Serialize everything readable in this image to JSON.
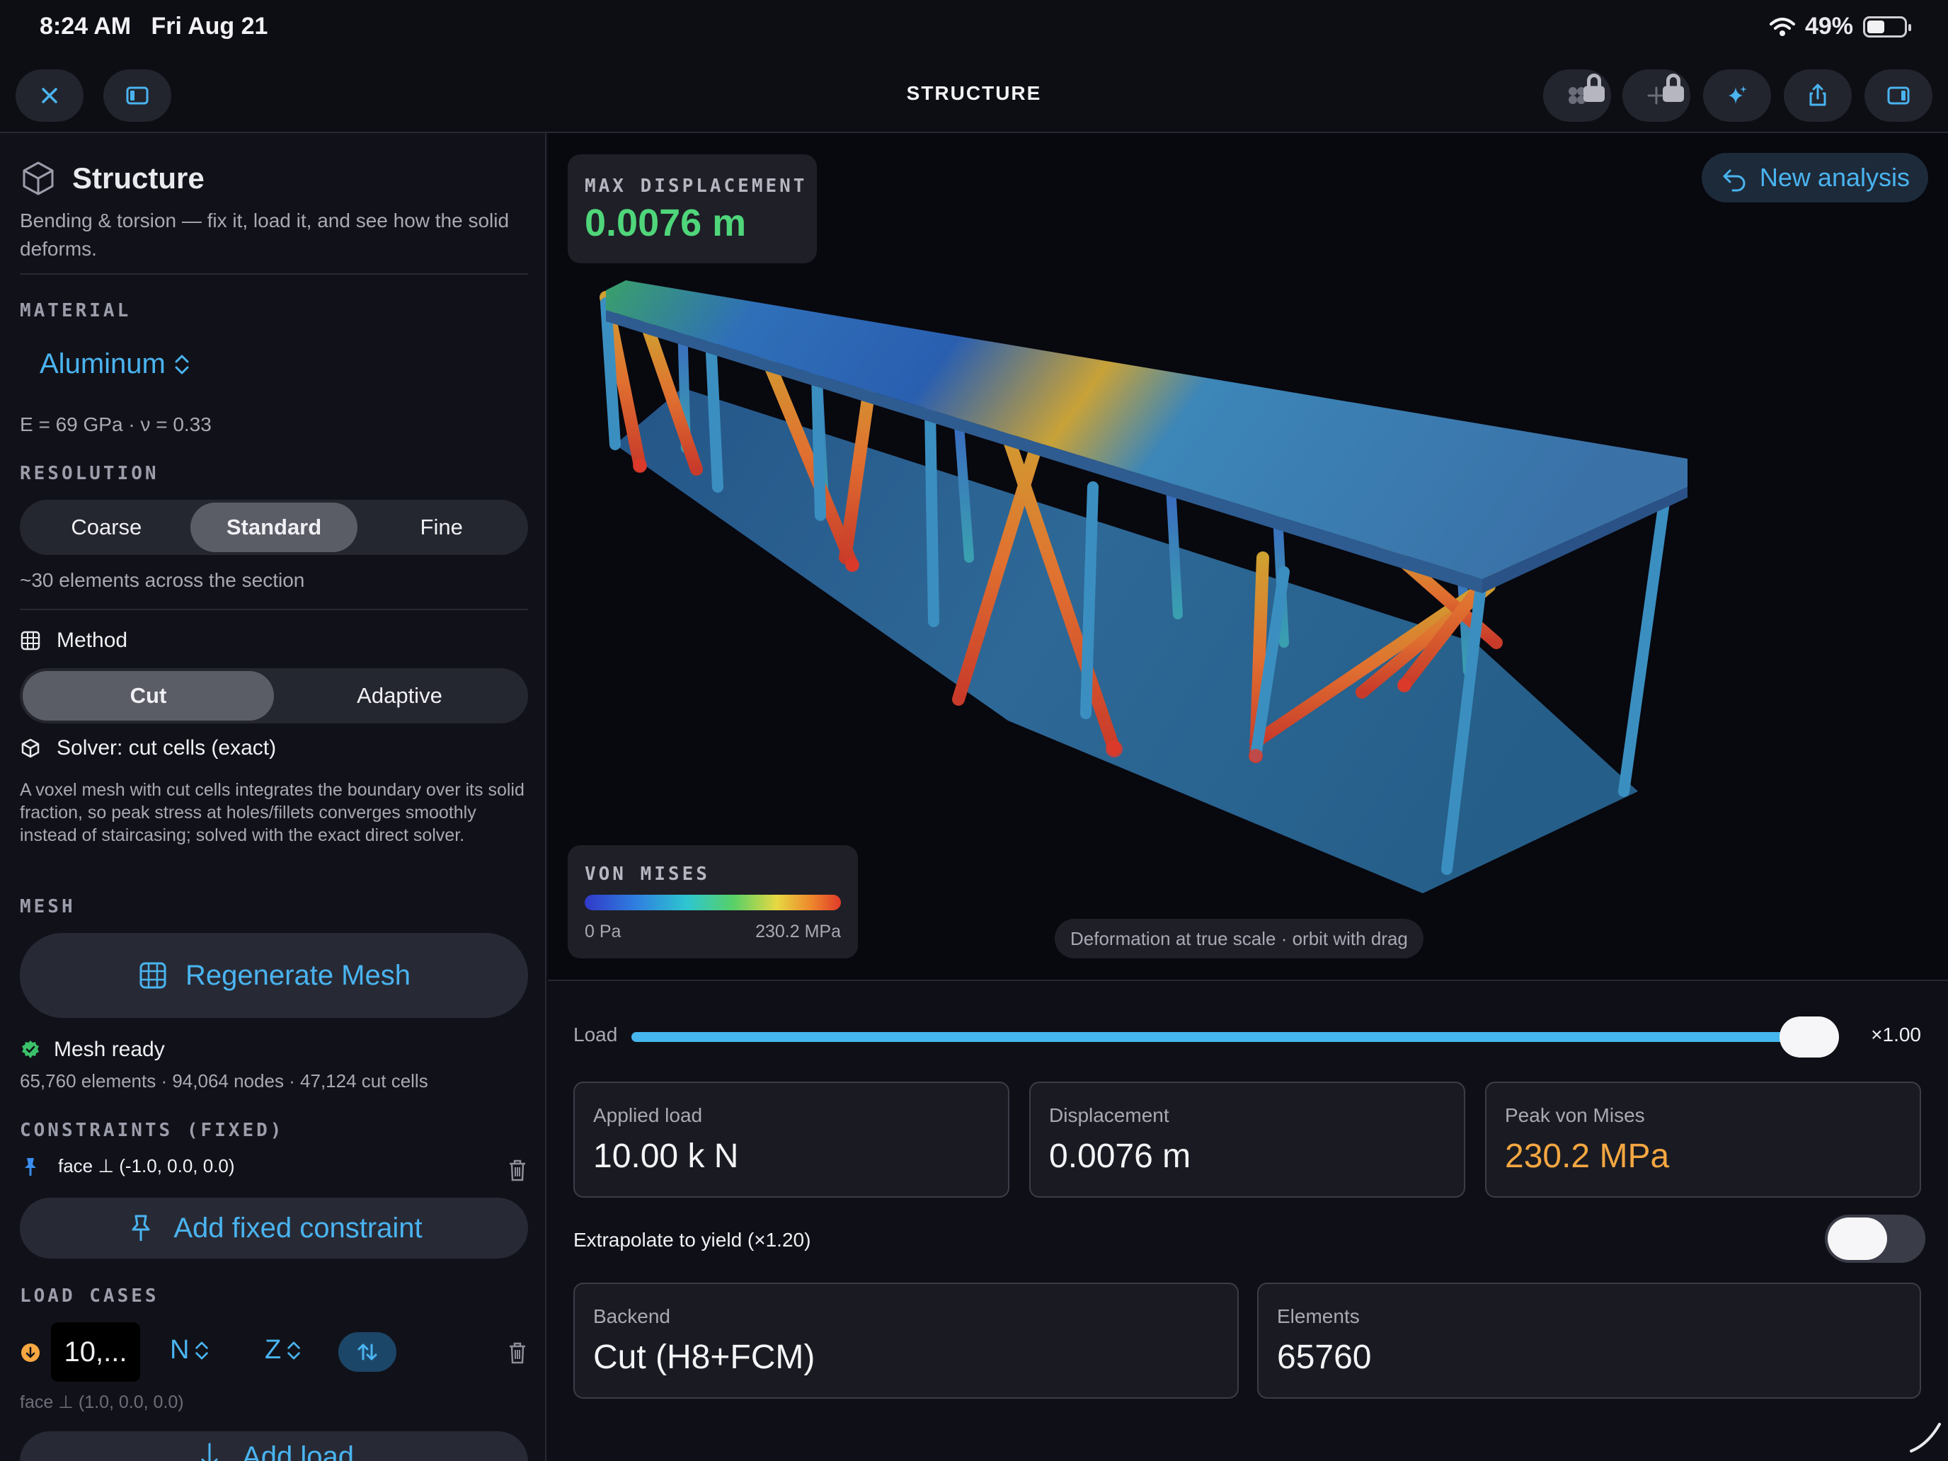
{
  "status": {
    "time": "8:24 AM",
    "date": "Fri Aug 21",
    "battery": "49%"
  },
  "toolbar": {
    "title": "STRUCTURE"
  },
  "sidebar": {
    "title": "Structure",
    "subtitle": "Bending & torsion — fix it, load it, and see how the solid deforms.",
    "material_label": "MATERIAL",
    "material_value": "Aluminum",
    "material_props": "E = 69 GPa · ν = 0.33",
    "resolution_label": "RESOLUTION",
    "resolution_options": [
      "Coarse",
      "Standard",
      "Fine"
    ],
    "resolution_selected": "Standard",
    "resolution_hint": "~30 elements across the section",
    "method_label": "Method",
    "method_options": [
      "Cut",
      "Adaptive"
    ],
    "method_selected": "Cut",
    "solver_label": "Solver: cut cells (exact)",
    "solver_desc": "A voxel mesh with cut cells integrates the boundary over its solid fraction, so peak stress at holes/fillets converges smoothly instead of staircasing; solved with the exact direct solver.",
    "mesh_label": "MESH",
    "regen_label": "Regenerate Mesh",
    "mesh_status": "Mesh ready",
    "mesh_stats": "65,760 elements · 94,064 nodes · 47,124 cut cells",
    "constraints_label": "CONSTRAINTS (FIXED)",
    "constraint_item": "face ⊥ (-1.0, 0.0, 0.0)",
    "add_constraint_label": "Add fixed constraint",
    "loadcases_label": "LOAD CASES",
    "load_value": "10,...",
    "load_unit": "N",
    "load_axis": "Z",
    "load_face": "face ⊥ (1.0, 0.0, 0.0)",
    "add_load_label": "Add load"
  },
  "viewport": {
    "maxdisp_label": "MAX DISPLACEMENT",
    "maxdisp_value": "0.0076 m",
    "new_analysis_label": "New analysis",
    "legend_title": "VON MISES",
    "legend_min": "0 Pa",
    "legend_max": "230.2 MPa",
    "hint": "Deformation at true scale · orbit with drag"
  },
  "panel": {
    "load_label": "Load",
    "load_multiplier": "×1.00",
    "load_fraction": 1.0,
    "applied_load_label": "Applied load",
    "applied_load_value": "10.00 k N",
    "displacement_label": "Displacement",
    "displacement_value": "0.0076 m",
    "peak_label": "Peak von Mises",
    "peak_value": "230.2 MPa",
    "extrapolate_label": "Extrapolate to yield (×1.20)",
    "extrapolate_on": false,
    "backend_label": "Backend",
    "backend_value": "Cut (H8+FCM)",
    "elements_label": "Elements",
    "elements_value": "65760"
  },
  "colors": {
    "accent": "#4ab4f0",
    "success": "#4fd67a",
    "warning": "#f5a742"
  }
}
